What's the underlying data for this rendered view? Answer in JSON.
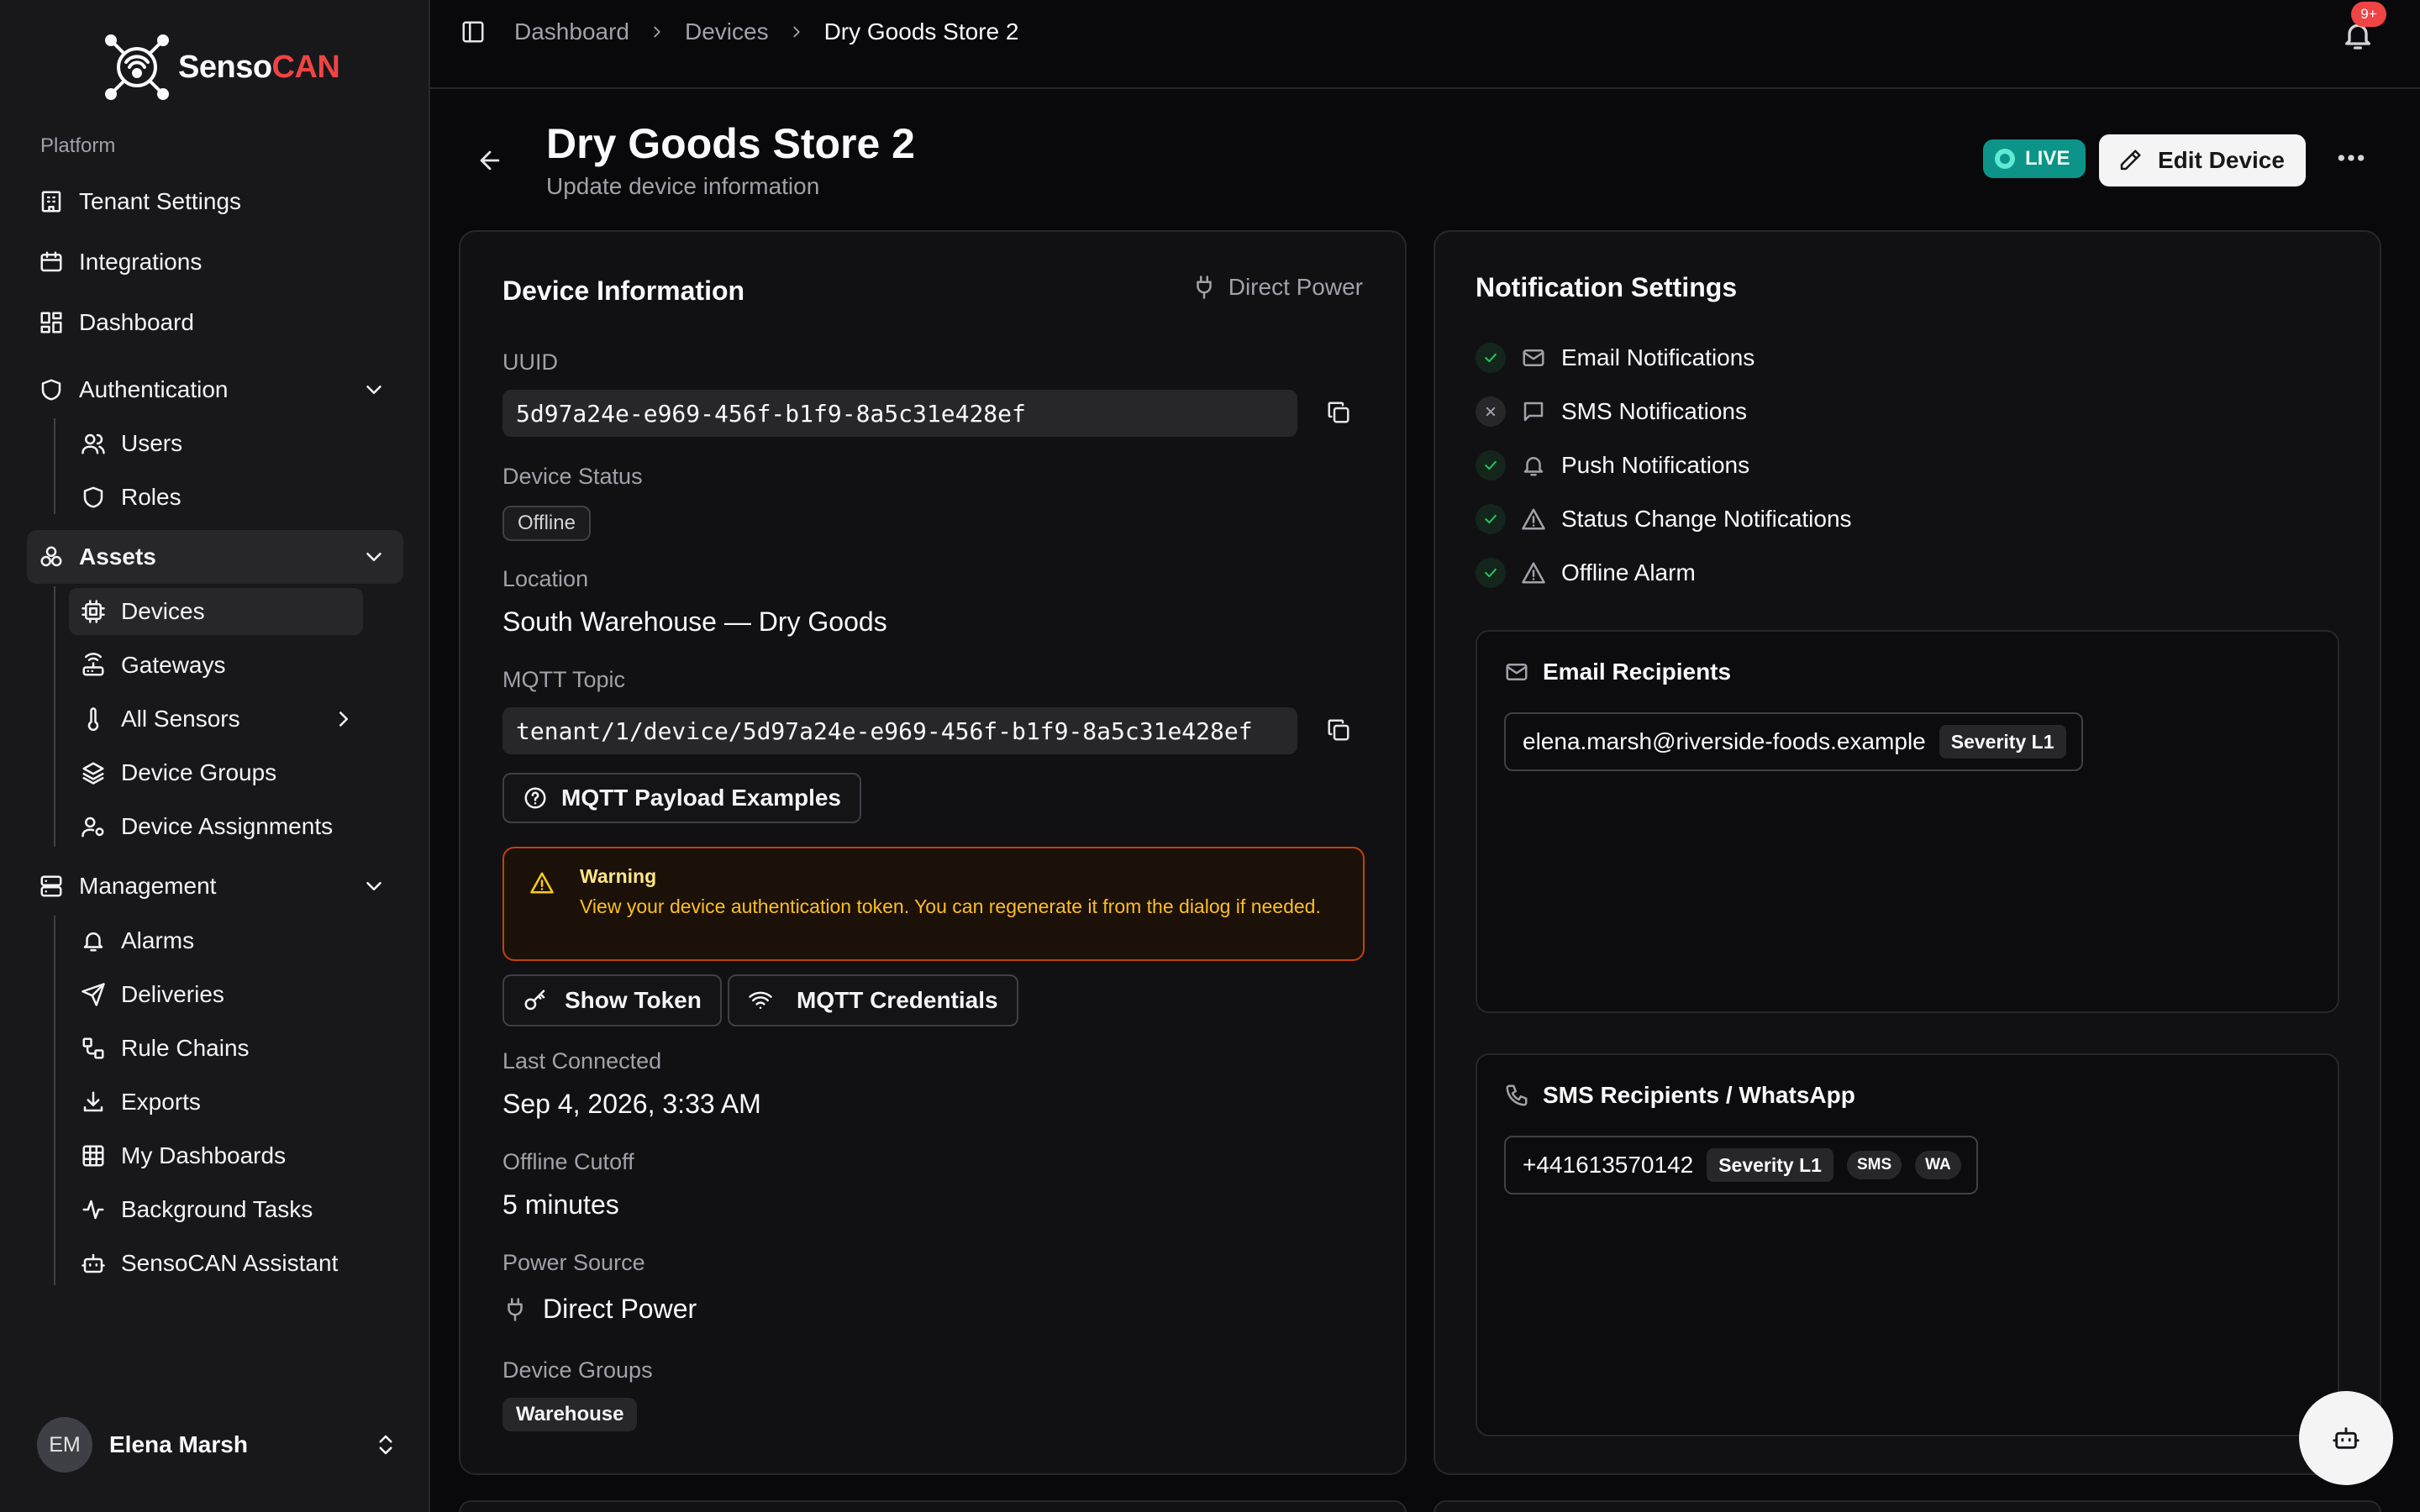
{
  "brand": {
    "name_main": "Senso",
    "name_accent": "CAN",
    "accent_color": "#ef4444"
  },
  "sidebar": {
    "group_label": "Platform",
    "items": [
      {
        "label": "Tenant Settings",
        "icon": "building-icon"
      },
      {
        "label": "Integrations",
        "icon": "calendar-icon"
      },
      {
        "label": "Dashboard",
        "icon": "dashboard-icon"
      },
      {
        "label": "Authentication",
        "icon": "shield-icon",
        "expanded": true,
        "children": [
          {
            "label": "Users",
            "icon": "users-icon"
          },
          {
            "label": "Roles",
            "icon": "shield-icon"
          }
        ]
      },
      {
        "label": "Assets",
        "icon": "boxes-icon",
        "expanded": true,
        "active": true,
        "children": [
          {
            "label": "Devices",
            "icon": "cpu-icon",
            "active": true
          },
          {
            "label": "Gateways",
            "icon": "router-icon"
          },
          {
            "label": "All Sensors",
            "icon": "thermometer-icon"
          },
          {
            "label": "Device Groups",
            "icon": "layers-icon"
          },
          {
            "label": "Device Assignments",
            "icon": "user-cog-icon"
          }
        ]
      },
      {
        "label": "Management",
        "icon": "server-icon",
        "expanded": true,
        "children": [
          {
            "label": "Alarms",
            "icon": "bell-icon"
          },
          {
            "label": "Deliveries",
            "icon": "send-icon"
          },
          {
            "label": "Rule Chains",
            "icon": "workflow-icon"
          },
          {
            "label": "Exports",
            "icon": "download-icon"
          },
          {
            "label": "My Dashboards",
            "icon": "grid-icon"
          },
          {
            "label": "Background Tasks",
            "icon": "activity-icon"
          },
          {
            "label": "SensoCAN Assistant",
            "icon": "bot-icon"
          }
        ]
      }
    ]
  },
  "user": {
    "initials": "EM",
    "name": "Elena Marsh"
  },
  "breadcrumb": [
    "Dashboard",
    "Devices",
    "Dry Goods Store 2"
  ],
  "notifications_badge": "9+",
  "header": {
    "title": "Dry Goods Store 2",
    "subtitle": "Update device information",
    "live_label": "LIVE",
    "live_color": "#0d9488",
    "edit_label": "Edit Device"
  },
  "device_info": {
    "title": "Device Information",
    "power_label": "Direct Power",
    "uuid_label": "UUID",
    "uuid": "5d97a24e-e969-456f-b1f9-8a5c31e428ef",
    "status_label": "Device Status",
    "status": "Offline",
    "location_label": "Location",
    "location": "South Warehouse — Dry Goods",
    "mqtt_label": "MQTT Topic",
    "mqtt_topic": "tenant/1/device/5d97a24e-e969-456f-b1f9-8a5c31e428ef",
    "payload_button": "MQTT Payload Examples",
    "warning_title": "Warning",
    "warning_body": "View your device authentication token. You can regenerate it from the dialog if needed.",
    "show_token": "Show Token",
    "mqtt_credentials": "MQTT Credentials",
    "last_connected_label": "Last Connected",
    "last_connected": "Sep 4, 2026, 3:33 AM",
    "offline_cutoff_label": "Offline Cutoff",
    "offline_cutoff": "5 minutes",
    "power_source_label": "Power Source",
    "power_source": "Direct Power",
    "groups_label": "Device Groups",
    "group": "Warehouse"
  },
  "notification_settings": {
    "title": "Notification Settings",
    "items": [
      {
        "label": "Email Notifications",
        "enabled": true,
        "icon": "mail-icon"
      },
      {
        "label": "SMS Notifications",
        "enabled": false,
        "icon": "message-icon"
      },
      {
        "label": "Push Notifications",
        "enabled": true,
        "icon": "bell-icon"
      },
      {
        "label": "Status Change Notifications",
        "enabled": true,
        "icon": "alert-triangle-icon"
      },
      {
        "label": "Offline Alarm",
        "enabled": true,
        "icon": "alert-triangle-icon"
      }
    ],
    "email_recipients": {
      "title": "Email Recipients",
      "email": "elena.marsh@riverside-foods.example",
      "severity": "Severity L1"
    },
    "sms_recipients": {
      "title": "SMS Recipients / WhatsApp",
      "phone": "+441613570142",
      "severity": "Severity L1",
      "sms_tag": "SMS",
      "wa_tag": "WA"
    }
  }
}
